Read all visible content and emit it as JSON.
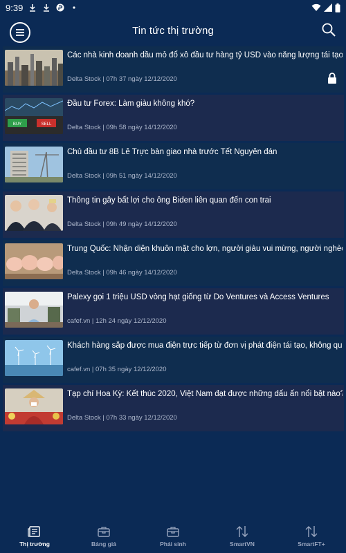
{
  "status_bar": {
    "time": "9:39"
  },
  "header": {
    "title": "Tin tức thị trường"
  },
  "news": [
    {
      "title": "Các nhà kinh doanh dầu mỏ đổ xô đầu tư hàng tỷ USD vào năng lượng tái tạo",
      "meta": "Delta Stock | 07h 37 ngày 12/12/2020",
      "locked": true
    },
    {
      "title": "Đầu tư Forex: Làm giàu không khó?",
      "meta": "Delta Stock | 09h 58 ngày 14/12/2020"
    },
    {
      "title": "Chủ đầu tư 8B Lê Trực bàn giao nhà trước Tết Nguyên đán",
      "meta": "Delta Stock | 09h 51 ngày 14/12/2020"
    },
    {
      "title": "Thông tin gây bất lợi cho ông Biden liên quan đến con trai",
      "meta": "Delta Stock | 09h 49 ngày 14/12/2020"
    },
    {
      "title": "Trung Quốc: Nhận diện khuôn mặt cho lợn, người giàu vui mừng, người nghèo lo phá sản",
      "meta": "Delta Stock | 09h 46 ngày 14/12/2020"
    },
    {
      "title": "Palexy gọi 1 triệu USD vòng hạt giống từ Do Ventures và Access Ventures",
      "meta": "cafef.vn | 12h 24 ngày 12/12/2020"
    },
    {
      "title": "Khách hàng sắp được mua điện trực tiếp từ đơn vị phát điện tái tạo, không qua EVN",
      "meta": "cafef.vn | 07h 35 ngày 12/12/2020"
    },
    {
      "title": "Tạp chí Hoa Kỳ: Kết thúc 2020, Việt Nam đạt được những dấu ấn nổi bật nào?",
      "meta": "Delta Stock | 07h 33 ngày 12/12/2020"
    }
  ],
  "thumb_labels": {
    "buy": "BUY",
    "sell": "SELL"
  },
  "bottom_nav": [
    {
      "label": "Thị trường",
      "icon": "news-icon",
      "active": true
    },
    {
      "label": "Bảng giá",
      "icon": "briefcase-icon"
    },
    {
      "label": "Phái sinh",
      "icon": "briefcase-icon"
    },
    {
      "label": "SmartVN",
      "icon": "updown-arrows-icon"
    },
    {
      "label": "SmartFT+",
      "icon": "updown-arrows-icon"
    }
  ],
  "colors": {
    "background": "#0b2a55",
    "item_bg": "#142a52",
    "meta_text": "#aeb8cc"
  }
}
